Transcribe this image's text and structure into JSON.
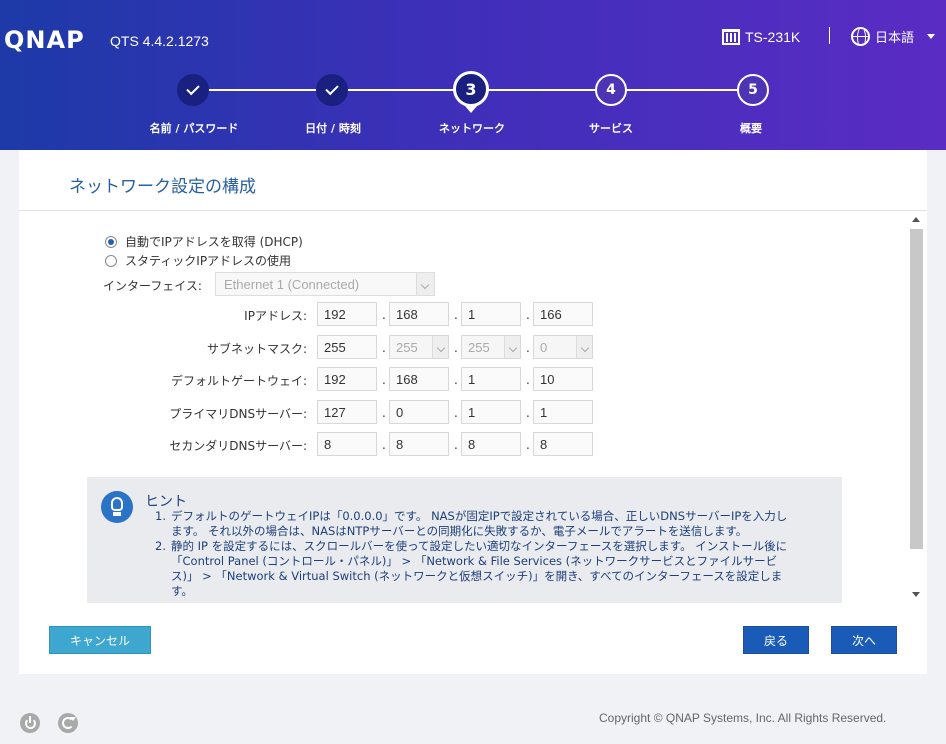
{
  "header": {
    "logo": "QNAP",
    "version": "QTS 4.4.2.1273",
    "model": "TS-231K",
    "language": "日本語"
  },
  "steps": [
    {
      "label": "名前 / パスワード",
      "state": "done"
    },
    {
      "label": "日付 / 時刻",
      "state": "done"
    },
    {
      "label": "ネットワーク",
      "number": "3",
      "state": "current"
    },
    {
      "label": "サービス",
      "number": "4",
      "state": "pending"
    },
    {
      "label": "概要",
      "number": "5",
      "state": "pending"
    }
  ],
  "panel": {
    "title": "ネットワーク設定の構成",
    "dhcp_label": "自動でIPアドレスを取得 (DHCP)",
    "static_label": "スタティックIPアドレスの使用",
    "interface_label": "インターフェイス:",
    "interface_value": "Ethernet 1 (Connected)",
    "fields": [
      {
        "label": "IPアドレス:",
        "octets": [
          "192",
          "168",
          "1",
          "166"
        ]
      },
      {
        "label": "サブネットマスク:",
        "octets": [
          "255",
          "255",
          "255",
          "0"
        ]
      },
      {
        "label": "デフォルトゲートウェイ:",
        "octets": [
          "192",
          "168",
          "1",
          "10"
        ]
      },
      {
        "label": "プライマリDNSサーバー:",
        "octets": [
          "127",
          "0",
          "1",
          "1"
        ]
      },
      {
        "label": "セカンダリDNSサーバー:",
        "octets": [
          "8",
          "8",
          "8",
          "8"
        ]
      }
    ],
    "hint": {
      "title": "ヒント",
      "items": [
        {
          "num": "1.",
          "lines": [
            "デフォルトのゲートウェイIPは「0.0.0.0」です。 NASが固定IPで設定されている場合、正しいDNSサーバーIPを入力し",
            "ます。 それ以外の場合は、NASはNTPサーバーとの同期化に失敗するか、電子メールでアラートを送信します。"
          ]
        },
        {
          "num": "2.",
          "lines": [
            "静的 IP を設定するには、スクロールバーを使って設定したい適切なインターフェースを選択します。 インストール後に",
            "「Control Panel (コントロール・パネル)」 > 「Network & File Services (ネットワークサービスとファイルサービ",
            "ス)」 > 「Network & Virtual Switch (ネットワークと仮想スイッチ)」を開き、すべてのインターフェースを設定しま",
            "す。"
          ]
        }
      ]
    }
  },
  "buttons": {
    "cancel": "キャンセル",
    "back": "戻る",
    "next": "次へ"
  },
  "footer": {
    "copyright": "Copyright © QNAP Systems, Inc. All Rights Reserved."
  },
  "colors": {
    "accent": "#1b5bb8",
    "header_start": "#1d3aa8",
    "header_end": "#5a2cc4",
    "cancel": "#3ea7d0"
  }
}
